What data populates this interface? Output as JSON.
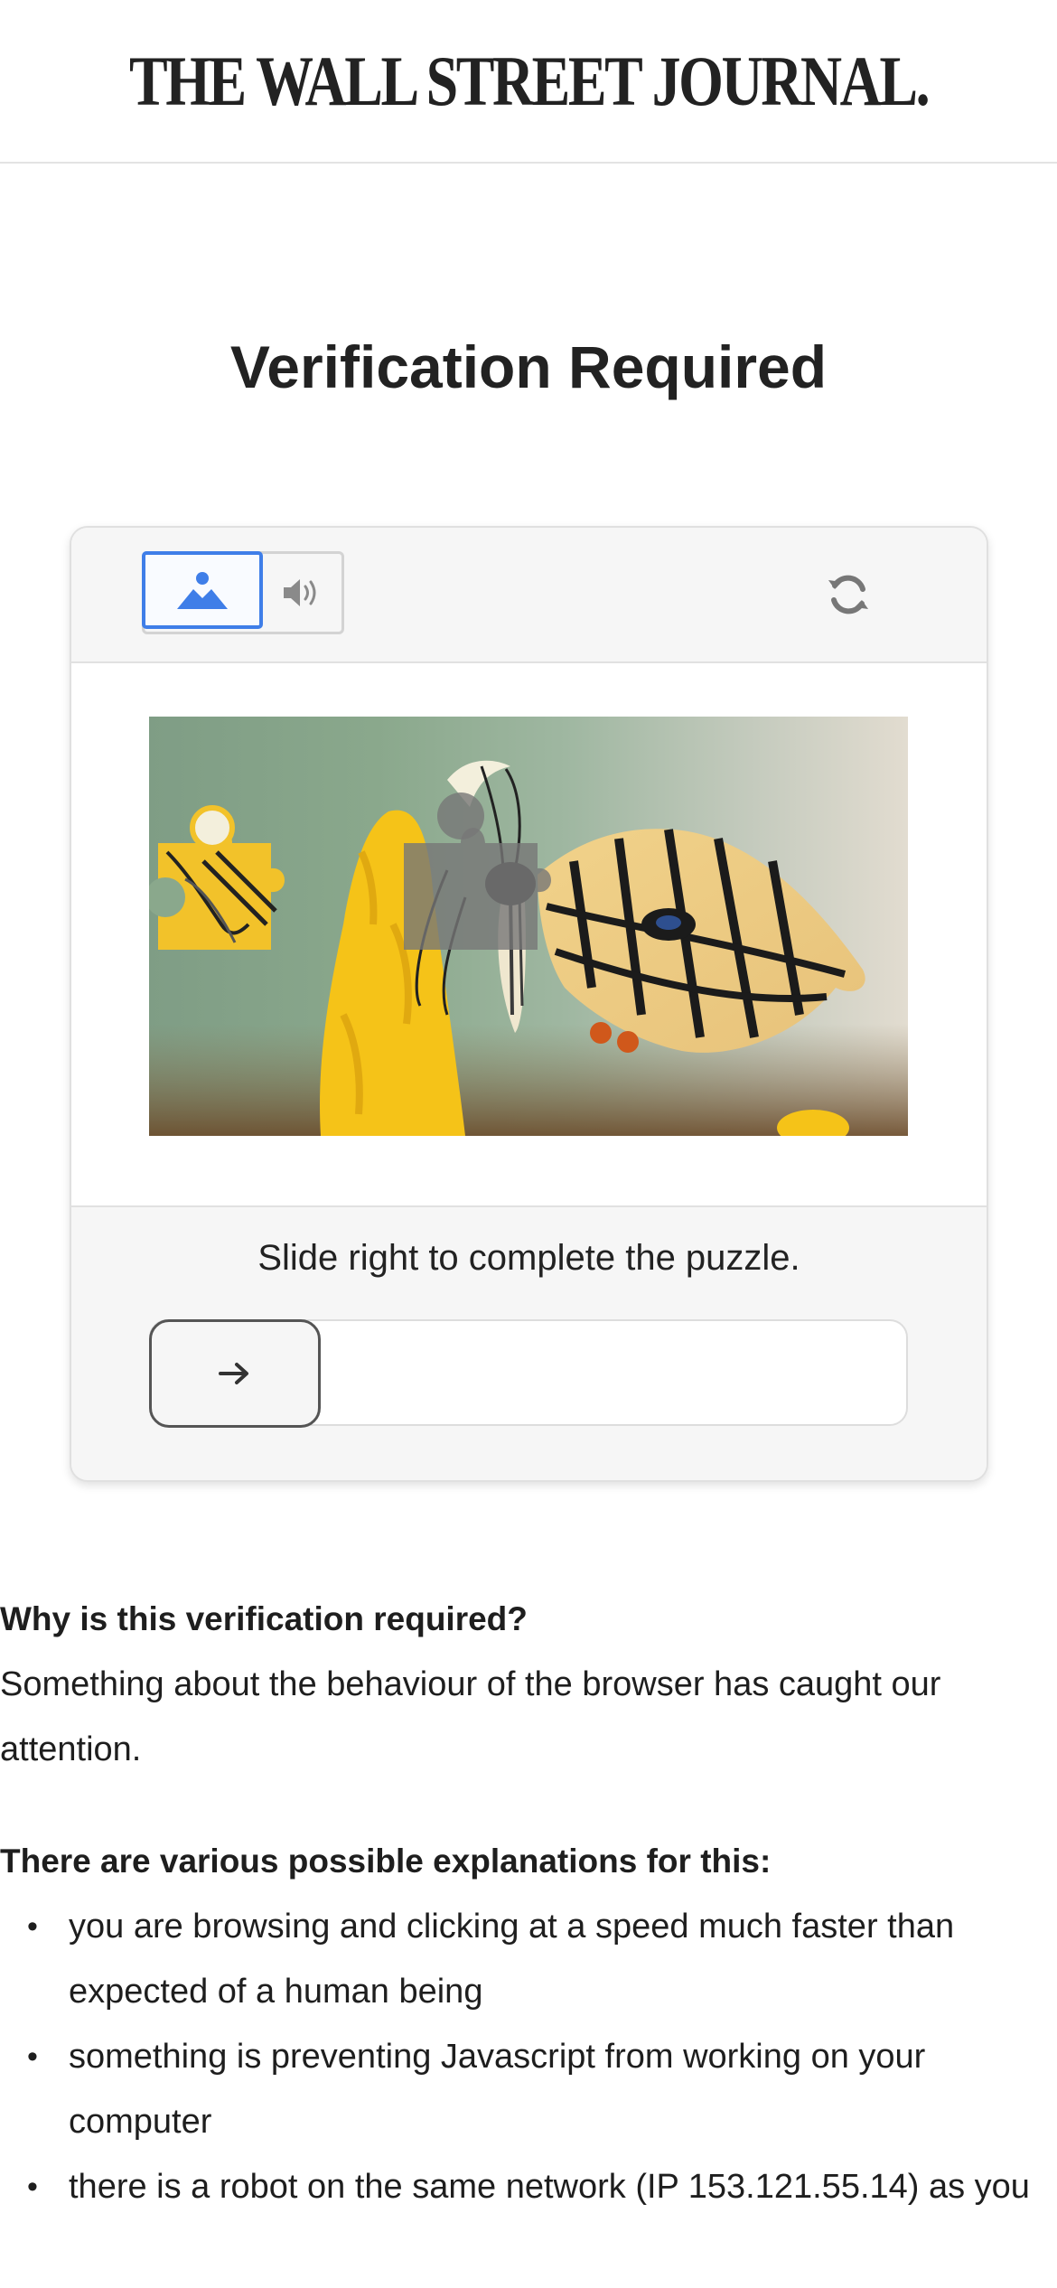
{
  "masthead": {
    "logo_text": "THE WALL STREET JOURNAL."
  },
  "page": {
    "title": "Verification Required"
  },
  "captcha": {
    "mode_toggle": {
      "image_icon": "image-mode-icon",
      "audio_icon": "audio-mode-icon",
      "selected": "image"
    },
    "refresh_icon": "refresh-icon",
    "instruction": "Slide right to complete the puzzle.",
    "slider": {
      "handle_icon": "arrow-right-icon",
      "progress": 0
    }
  },
  "info": {
    "why_heading": "Why is this verification required?",
    "why_text": "Something about the behaviour of the browser has caught our attention.",
    "explanations_heading": "There are various possible explanations for this:",
    "explanations": [
      "you are browsing and clicking at a speed much faster than expected of a human being",
      "something is preventing Javascript from working on your computer",
      "there is a robot on the same network (IP 153.121.55.14) as you"
    ]
  },
  "colors": {
    "accent": "#3f7ee8",
    "card_bg": "#f6f6f6",
    "border": "#e0e0e0"
  }
}
